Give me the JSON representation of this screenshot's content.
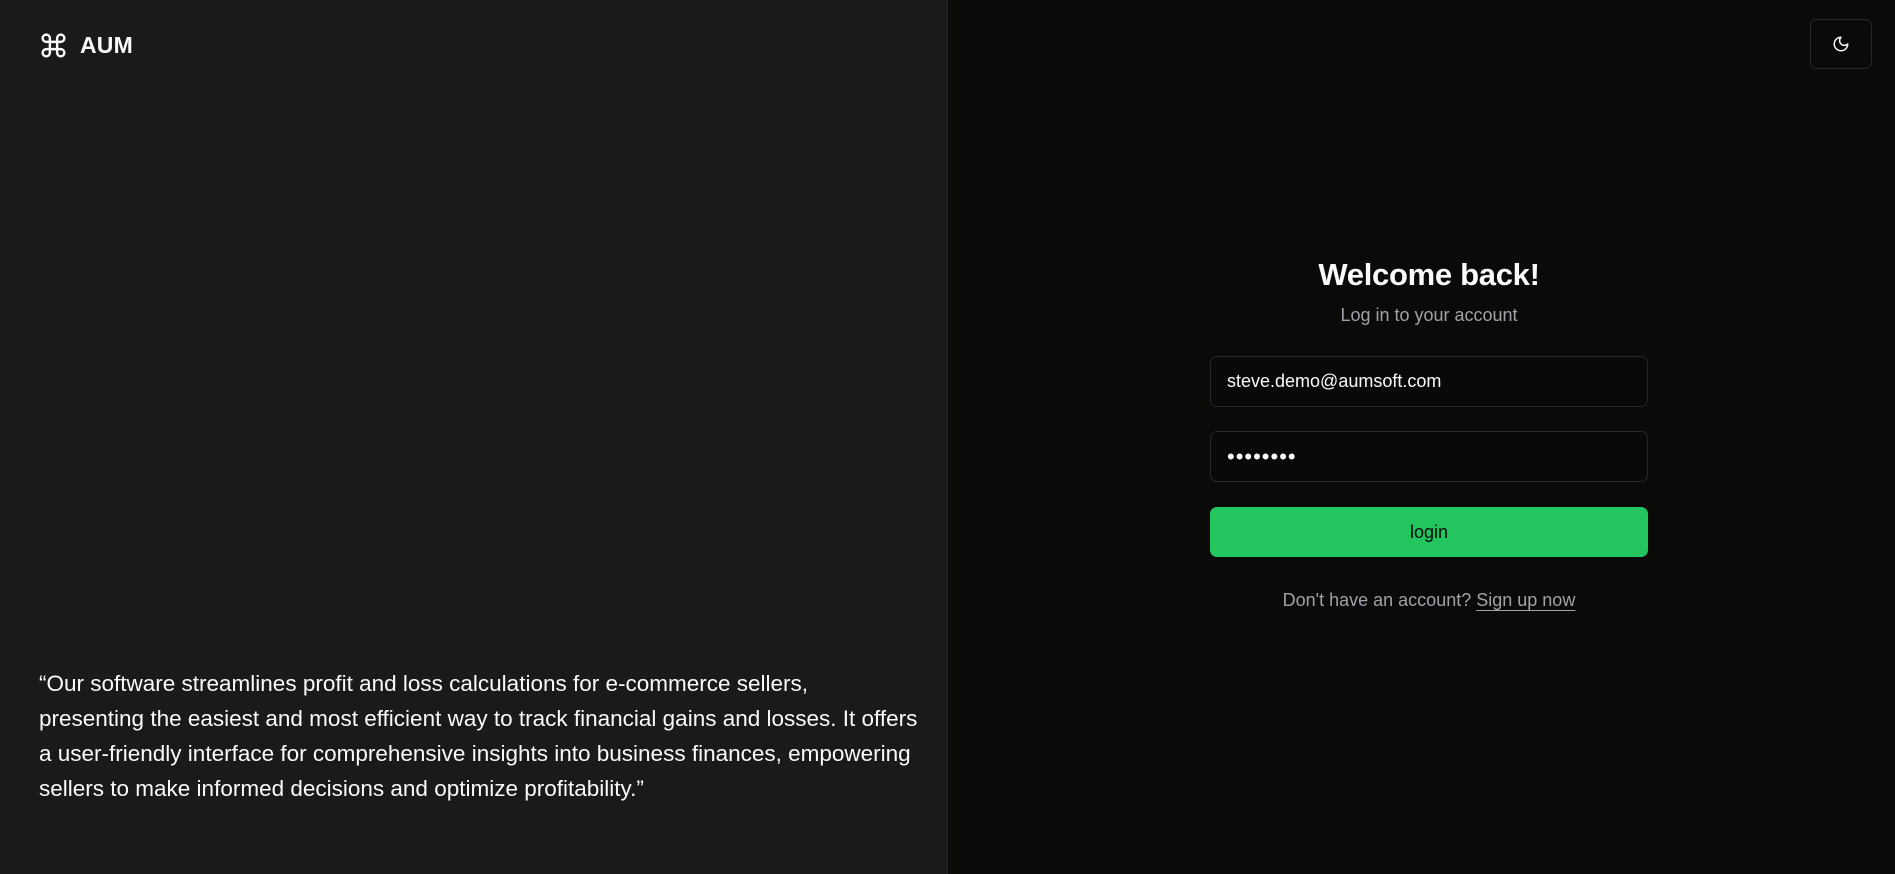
{
  "brand": {
    "name": "AUM",
    "icon": "command-icon"
  },
  "testimonial": {
    "quote": "“Our software streamlines profit and loss calculations for e-commerce sellers, presenting the easiest and most efficient way to track financial gains and losses. It offers a user-friendly interface for comprehensive insights into business finances, empowering sellers to make informed decisions and optimize profitability.”"
  },
  "theme_toggle": {
    "icon": "moon-icon"
  },
  "login": {
    "title": "Welcome back!",
    "subtitle": "Log in to your account",
    "email_value": "steve.demo@aumsoft.com",
    "password_value": "••••••••",
    "button_label": "login",
    "signup_prompt": "Don't have an account?",
    "signup_link": "Sign up now"
  },
  "colors": {
    "left_panel_bg": "#1a1a1c",
    "right_panel_bg": "#0a0a09",
    "accent": "#22c55e",
    "muted_text": "#a1a1aa",
    "border": "#27272a"
  }
}
